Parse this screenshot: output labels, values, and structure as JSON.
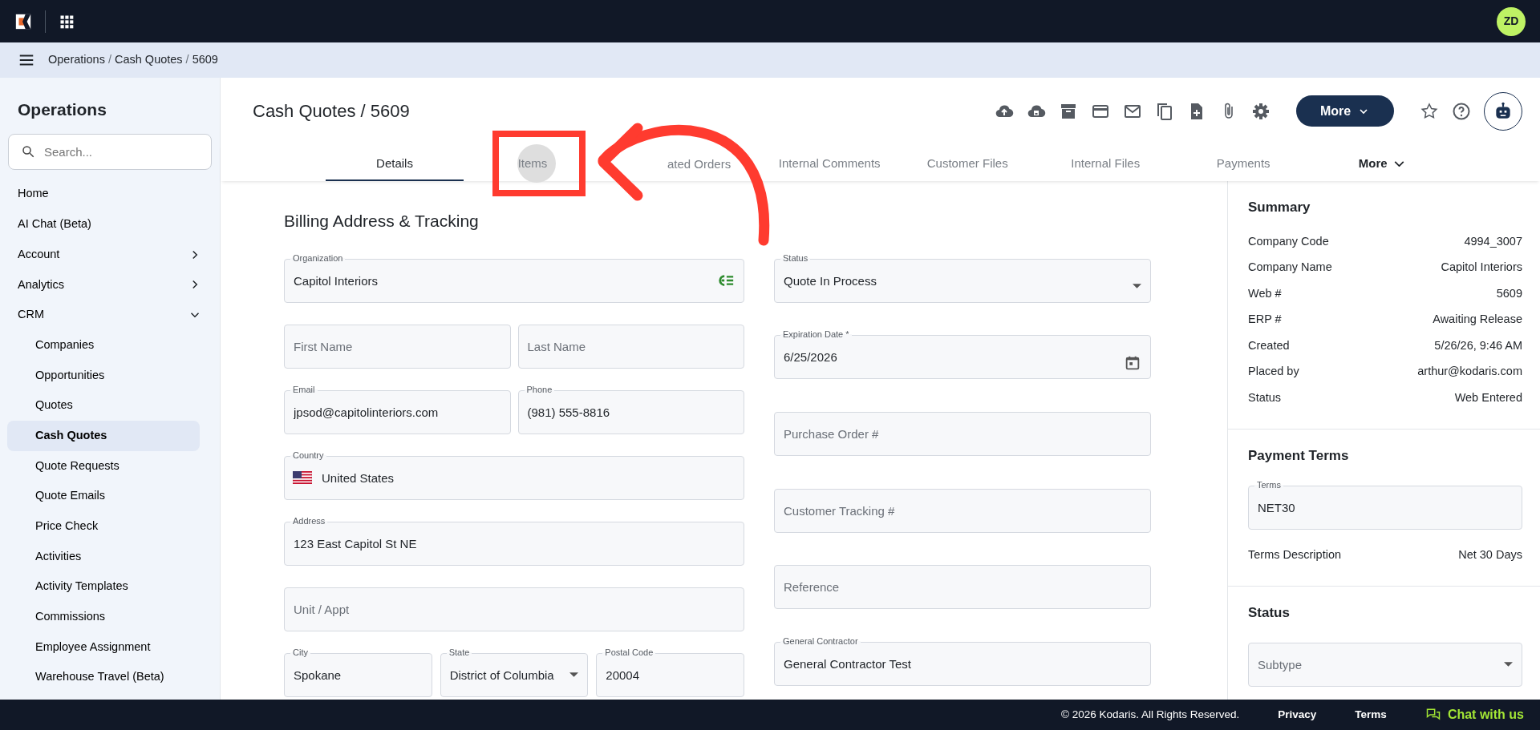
{
  "top_bar": {
    "avatar": "ZD"
  },
  "breadcrumb": {
    "separator": "/",
    "items": [
      {
        "label": "Operations"
      },
      {
        "label": "Cash Quotes"
      },
      {
        "label": "5609"
      }
    ]
  },
  "sidebar": {
    "title": "Operations",
    "search": {
      "placeholder": "Search..."
    },
    "items": [
      {
        "label": "Home",
        "kind": "link",
        "selected": false
      },
      {
        "label": "AI Chat (Beta)",
        "kind": "link",
        "selected": false
      },
      {
        "label": "Account",
        "kind": "group",
        "expanded": false,
        "selected": false
      },
      {
        "label": "Analytics",
        "kind": "group",
        "expanded": false,
        "selected": false
      },
      {
        "label": "CRM",
        "kind": "group",
        "expanded": true,
        "selected": false,
        "children": [
          {
            "label": "Companies",
            "selected": false
          },
          {
            "label": "Opportunities",
            "selected": false
          },
          {
            "label": "Quotes",
            "selected": false
          },
          {
            "label": "Cash Quotes",
            "selected": true
          },
          {
            "label": "Quote Requests",
            "selected": false
          },
          {
            "label": "Quote Emails",
            "selected": false
          },
          {
            "label": "Price Check",
            "selected": false
          },
          {
            "label": "Activities",
            "selected": false
          },
          {
            "label": "Activity Templates",
            "selected": false
          },
          {
            "label": "Commissions",
            "selected": false
          },
          {
            "label": "Employee Assignment",
            "selected": false
          },
          {
            "label": "Warehouse Travel (Beta)",
            "selected": false
          }
        ]
      }
    ]
  },
  "header": {
    "title": "Cash Quotes / 5609",
    "more_button": "More"
  },
  "tabs": [
    {
      "label": "Details",
      "selected": true
    },
    {
      "label": "Items",
      "selected": false
    },
    {
      "label": "ated Orders",
      "selected": false
    },
    {
      "label": "Internal Comments",
      "selected": false
    },
    {
      "label": "Customer Files",
      "selected": false
    },
    {
      "label": "Internal Files",
      "selected": false
    },
    {
      "label": "Payments",
      "selected": false
    },
    {
      "label": "More",
      "selected": false,
      "kind": "menu"
    }
  ],
  "form": {
    "title": "Billing Address & Tracking",
    "left": [
      [
        {
          "kind": "lookup",
          "label": "Organization",
          "value": "Capitol Interiors"
        }
      ],
      [
        {
          "kind": "text",
          "placeholder": "First Name"
        },
        {
          "kind": "text",
          "placeholder": "Last Name"
        }
      ],
      [
        {
          "kind": "text",
          "label": "Email",
          "value": "jpsod@capitolinteriors.com"
        },
        {
          "kind": "text",
          "label": "Phone",
          "value": "(981) 555-8816"
        }
      ],
      [
        {
          "kind": "country",
          "label": "Country",
          "value": "United States"
        }
      ],
      [
        {
          "kind": "text",
          "label": "Address",
          "value": "123 East Capitol St NE"
        }
      ],
      [
        {
          "kind": "text",
          "placeholder": "Unit / Appt"
        }
      ],
      [
        {
          "kind": "text",
          "label": "City",
          "value": "Spokane"
        },
        {
          "kind": "select",
          "label": "State",
          "value": "District of Columbia"
        },
        {
          "kind": "text",
          "label": "Postal Code",
          "value": "20004"
        }
      ]
    ],
    "right": [
      {
        "kind": "select",
        "label": "Status",
        "value": "Quote In Process"
      },
      {
        "kind": "date",
        "label": "Expiration Date *",
        "value": "6/25/2026"
      },
      {
        "kind": "text",
        "placeholder": "Purchase Order #"
      },
      {
        "kind": "text",
        "placeholder": "Customer Tracking #"
      },
      {
        "kind": "text",
        "placeholder": "Reference"
      },
      {
        "kind": "text",
        "label": "General Contractor",
        "value": "General Contractor Test"
      }
    ]
  },
  "panel": {
    "summary": {
      "title": "Summary",
      "rows": [
        {
          "label": "Company Code",
          "value": "4994_3007"
        },
        {
          "label": "Company Name",
          "value": "Capitol Interiors"
        },
        {
          "label": "Web #",
          "value": "5609"
        },
        {
          "label": "ERP #",
          "value": "Awaiting Release"
        },
        {
          "label": "Created",
          "value": "5/26/26, 9:46 AM"
        },
        {
          "label": "Placed by",
          "value": "arthur@kodaris.com"
        },
        {
          "label": "Status",
          "value": "Web Entered"
        }
      ]
    },
    "payment_terms": {
      "title": "Payment Terms",
      "terms": {
        "label": "Terms",
        "value": "NET30"
      },
      "description": {
        "label": "Terms Description",
        "value": "Net 30 Days"
      }
    },
    "status": {
      "title": "Status",
      "subtype": {
        "kind": "select",
        "placeholder": "Subtype"
      }
    }
  },
  "footer": {
    "copyright": "© 2026 Kodaris. All Rights Reserved.",
    "links": [
      "Privacy",
      "Terms"
    ],
    "chat": "Chat with us"
  }
}
